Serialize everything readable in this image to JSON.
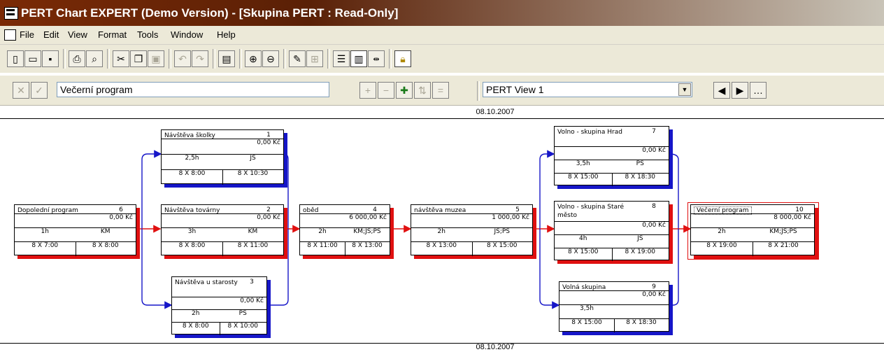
{
  "window": {
    "title": "PERT Chart EXPERT (Demo Version) - [Skupina PERT : Read-Only]"
  },
  "menu": [
    "File",
    "Edit",
    "View",
    "Format",
    "Tools",
    "Window",
    "Help"
  ],
  "toolbar": {
    "task_name": "Večerní program",
    "view": "PERT View 1"
  },
  "timeline": {
    "top_date": "08.10.2007",
    "bottom_date": "08.10.2007"
  },
  "tasks": [
    {
      "name": "Dopolední program",
      "id": "6",
      "cost": "0,00 Kč",
      "duration": "1h",
      "resource": "KM",
      "start": "8 X 7:00",
      "finish": "8 X 8:00"
    },
    {
      "name": "Návštěva školky",
      "id": "1",
      "cost": "0,00 Kč",
      "duration": "2,5h",
      "resource": "JS",
      "start": "8 X 8:00",
      "finish": "8 X 10:30"
    },
    {
      "name": "Návštěva továrny",
      "id": "2",
      "cost": "0,00 Kč",
      "duration": "3h",
      "resource": "KM",
      "start": "8 X 8:00",
      "finish": "8 X 11:00"
    },
    {
      "name": "Návštěva u starosty",
      "id": "3",
      "cost": "0,00 Kč",
      "duration": "2h",
      "resource": "PS",
      "start": "8 X 8:00",
      "finish": "8 X 10:00"
    },
    {
      "name": "oběd",
      "id": "4",
      "cost": "6 000,00 Kč",
      "duration": "2h",
      "resource": "KM;JS;PS",
      "start": "8 X 11:00",
      "finish": "8 X 13:00"
    },
    {
      "name": "návštěva muzea",
      "id": "5",
      "cost": "1 000,00 Kč",
      "duration": "2h",
      "resource": "JS;PS",
      "start": "8 X 13:00",
      "finish": "8 X 15:00"
    },
    {
      "name": "Volno - skupina Hrad",
      "id": "7",
      "cost": "0,00 Kč",
      "duration": "3,5h",
      "resource": "PS",
      "start": "8 X 15:00",
      "finish": "8 X 18:30"
    },
    {
      "name": "Volno - skupina Staré město",
      "id": "8",
      "cost": "0,00 Kč",
      "duration": "4h",
      "resource": "JS",
      "start": "8 X 15:00",
      "finish": "8 X 19:00"
    },
    {
      "name": "Volná skupina",
      "id": "9",
      "cost": "0,00 Kč",
      "duration": "3,5h",
      "resource": "",
      "start": "8 X 15:00",
      "finish": "8 X 18:30"
    },
    {
      "name": "Večerní program",
      "id": "10",
      "cost": "8 000,00 Kč",
      "duration": "2h",
      "resource": "KM;JS;PS",
      "start": "8 X 19:00",
      "finish": "8 X 21:00"
    }
  ],
  "colors": {
    "critical": "#e01010",
    "noncritical": "#1616c8",
    "titlebar": "#5a2006"
  }
}
